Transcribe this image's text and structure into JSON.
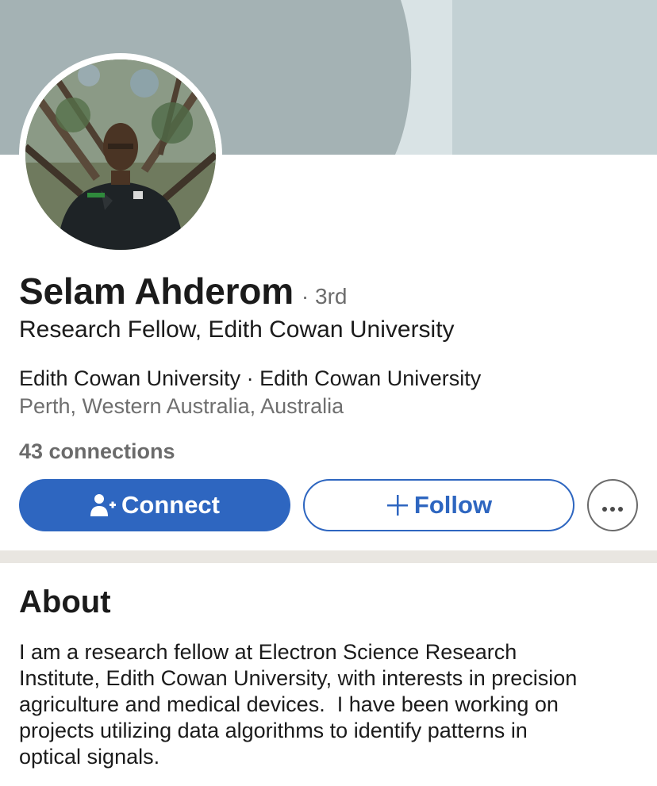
{
  "profile": {
    "name": "Selam Ahderom",
    "degree": "· 3rd",
    "headline": "Research Fellow, Edith Cowan University",
    "company": "Edith Cowan University · Edith Cowan University",
    "location": "Perth, Western Australia, Australia",
    "connections": "43 connections"
  },
  "actions": {
    "connect_label": "Connect",
    "connect_icon": "add-person-icon",
    "follow_label": "Follow",
    "follow_icon": "plus-icon",
    "more_icon": "more-horizontal-icon"
  },
  "about": {
    "title": "About",
    "text": "I am a research fellow at Electron Science Research\nInstitute, Edith Cowan University, with interests in precision\nagriculture and medical devices.  I have been working on\nprojects utilizing data algorithms to identify patterns in\noptical signals."
  },
  "colors": {
    "accent": "#2e66c0",
    "cover_left": "#a4b2b4",
    "cover_strip": "#d9e3e5",
    "cover_right": "#c3d1d4",
    "divider": "#e9e6e1"
  }
}
